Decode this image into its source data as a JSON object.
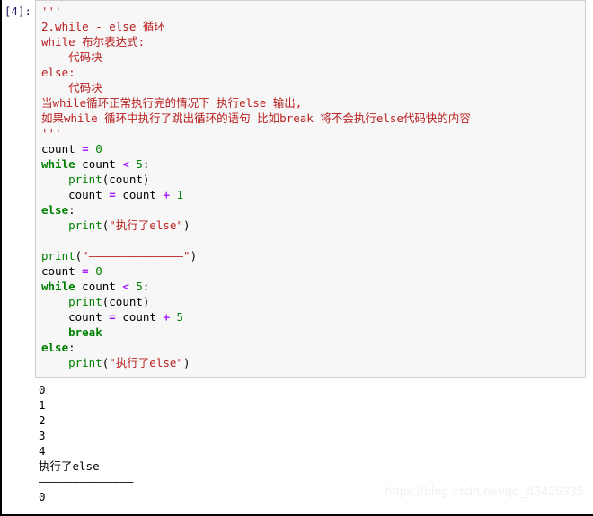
{
  "notebook": {
    "prompt_label": "[4]:",
    "code_cell": {
      "lines": [
        {
          "tokens": [
            {
              "t": "'''",
              "c": "str"
            }
          ]
        },
        {
          "tokens": [
            {
              "t": "2.while - else 循环",
              "c": "str"
            }
          ]
        },
        {
          "tokens": [
            {
              "t": "while 布尔表达式:",
              "c": "str"
            }
          ]
        },
        {
          "tokens": [
            {
              "t": "    代码块",
              "c": "str"
            }
          ]
        },
        {
          "tokens": [
            {
              "t": "else:",
              "c": "str"
            }
          ]
        },
        {
          "tokens": [
            {
              "t": "    代码块",
              "c": "str"
            }
          ]
        },
        {
          "tokens": [
            {
              "t": "当while循环正常执行完的情况下 执行else 输出,",
              "c": "str"
            }
          ]
        },
        {
          "tokens": [
            {
              "t": "如果while 循环中执行了跳出循环的语句 比如break 将不会执行else代码快的内容",
              "c": "str"
            }
          ]
        },
        {
          "tokens": [
            {
              "t": "'''",
              "c": "str"
            }
          ]
        },
        {
          "tokens": [
            {
              "t": "count ",
              "c": "pl"
            },
            {
              "t": "=",
              "c": "op"
            },
            {
              "t": " ",
              "c": "pl"
            },
            {
              "t": "0",
              "c": "num"
            }
          ]
        },
        {
          "tokens": [
            {
              "t": "while",
              "c": "kw"
            },
            {
              "t": " count ",
              "c": "pl"
            },
            {
              "t": "<",
              "c": "op"
            },
            {
              "t": " ",
              "c": "pl"
            },
            {
              "t": "5",
              "c": "num"
            },
            {
              "t": ":",
              "c": "pl"
            }
          ]
        },
        {
          "tokens": [
            {
              "t": "    ",
              "c": "pl"
            },
            {
              "t": "print",
              "c": "bi"
            },
            {
              "t": "(count)",
              "c": "pl"
            }
          ]
        },
        {
          "tokens": [
            {
              "t": "    count ",
              "c": "pl"
            },
            {
              "t": "=",
              "c": "op"
            },
            {
              "t": " count ",
              "c": "pl"
            },
            {
              "t": "+",
              "c": "op"
            },
            {
              "t": " ",
              "c": "pl"
            },
            {
              "t": "1",
              "c": "num"
            }
          ]
        },
        {
          "tokens": [
            {
              "t": "else",
              "c": "kw"
            },
            {
              "t": ":",
              "c": "pl"
            }
          ]
        },
        {
          "tokens": [
            {
              "t": "    ",
              "c": "pl"
            },
            {
              "t": "print",
              "c": "bi"
            },
            {
              "t": "(",
              "c": "pl"
            },
            {
              "t": "\"执行了else\"",
              "c": "str"
            },
            {
              "t": ")",
              "c": "pl"
            }
          ]
        },
        {
          "tokens": [
            {
              "t": "",
              "c": "pl"
            }
          ]
        },
        {
          "tokens": [
            {
              "t": "print",
              "c": "bi"
            },
            {
              "t": "(",
              "c": "pl"
            },
            {
              "t": "\"——————————————\"",
              "c": "str"
            },
            {
              "t": ")",
              "c": "pl"
            }
          ]
        },
        {
          "tokens": [
            {
              "t": "count ",
              "c": "pl"
            },
            {
              "t": "=",
              "c": "op"
            },
            {
              "t": " ",
              "c": "pl"
            },
            {
              "t": "0",
              "c": "num"
            }
          ]
        },
        {
          "tokens": [
            {
              "t": "while",
              "c": "kw"
            },
            {
              "t": " count ",
              "c": "pl"
            },
            {
              "t": "<",
              "c": "op"
            },
            {
              "t": " ",
              "c": "pl"
            },
            {
              "t": "5",
              "c": "num"
            },
            {
              "t": ":",
              "c": "pl"
            }
          ]
        },
        {
          "tokens": [
            {
              "t": "    ",
              "c": "pl"
            },
            {
              "t": "print",
              "c": "bi"
            },
            {
              "t": "(count)",
              "c": "pl"
            }
          ]
        },
        {
          "tokens": [
            {
              "t": "    count ",
              "c": "pl"
            },
            {
              "t": "=",
              "c": "op"
            },
            {
              "t": " count ",
              "c": "pl"
            },
            {
              "t": "+",
              "c": "op"
            },
            {
              "t": " ",
              "c": "pl"
            },
            {
              "t": "5",
              "c": "num"
            }
          ]
        },
        {
          "tokens": [
            {
              "t": "    ",
              "c": "pl"
            },
            {
              "t": "break",
              "c": "kw"
            }
          ]
        },
        {
          "tokens": [
            {
              "t": "else",
              "c": "kw"
            },
            {
              "t": ":",
              "c": "pl"
            }
          ]
        },
        {
          "tokens": [
            {
              "t": "    ",
              "c": "pl"
            },
            {
              "t": "print",
              "c": "bi"
            },
            {
              "t": "(",
              "c": "pl"
            },
            {
              "t": "\"执行了else\"",
              "c": "str"
            },
            {
              "t": ")",
              "c": "pl"
            }
          ]
        }
      ]
    },
    "output_cell": {
      "text": "0\n1\n2\n3\n4\n执行了else\n——————————————\n0"
    }
  },
  "watermark": {
    "text": "https://blog.csdn.net/qq_43426335"
  },
  "colors": {
    "string": "#ba2121",
    "keyword": "#008000",
    "builtin": "#008000",
    "number": "#008000",
    "operator": "#aa22ff",
    "plain": "#000000",
    "prompt": "#202060",
    "cell_background": "#f7f7f7",
    "cell_border": "#cfcfcf",
    "page_background": "#ffffff"
  }
}
